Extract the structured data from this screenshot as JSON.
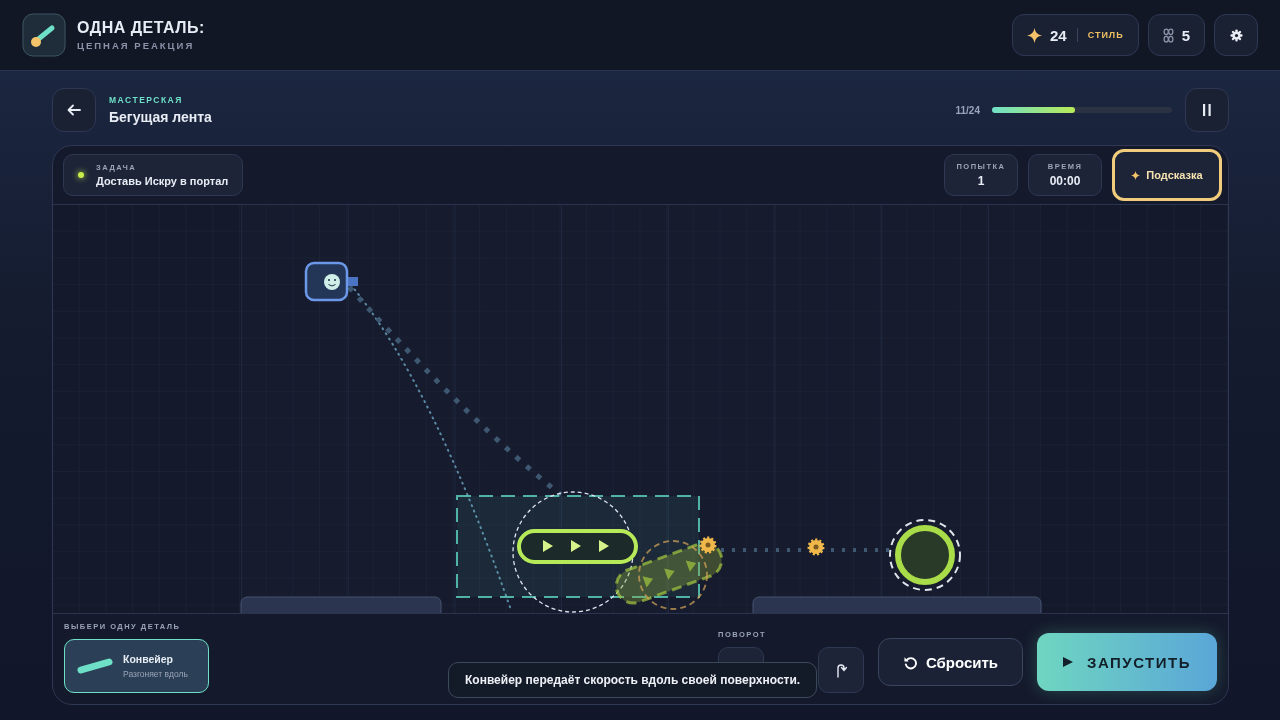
{
  "app": {
    "title": "ОДНА ДЕТАЛЬ:",
    "subtitle": "ЦЕПНАЯ РЕАКЦИЯ"
  },
  "stats": {
    "style_points": "24",
    "style_label": "СТИЛЬ",
    "links": "5"
  },
  "level": {
    "chapter": "МАСТЕРСКАЯ",
    "name": "Бегущая лента",
    "progress_text": "11/24",
    "level": 0.46
  },
  "task": {
    "label": "ЗАДАЧА",
    "text": "Доставь Искру в портал"
  },
  "counters": [
    {
      "label": "ПОПЫТКА",
      "value": "1"
    },
    {
      "label": "ВРЕМЯ",
      "value": "00:00"
    }
  ],
  "hint_button": {
    "label": "Подсказка"
  },
  "parts": {
    "label": "ВЫБЕРИ ОДНУ ДЕТАЛЬ",
    "items": [
      {
        "name": "Конвейер",
        "description": "Разгоняет вдоль",
        "selected": true
      }
    ]
  },
  "rotation": {
    "label": "ПОВОРОТ"
  },
  "tooltip": "Конвейер передаёт скорость вдоль своей поверхности.",
  "reset_button": "Сбросить",
  "run_button": "ЗАПУСТИТЬ"
}
